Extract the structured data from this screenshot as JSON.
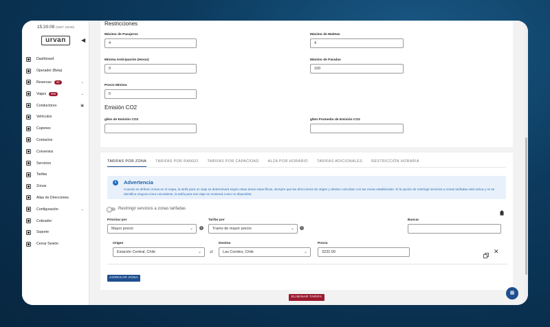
{
  "clock": {
    "time": "15:20:09",
    "tz": "(GMT -04:00)"
  },
  "logo": "urvan",
  "sidebar": {
    "items": [
      {
        "label": "Dashboard",
        "icon": "dashboard-icon"
      },
      {
        "label": "Operador (Beta)",
        "icon": "operator-icon"
      },
      {
        "label": "Reservas",
        "icon": "reservations-icon",
        "badge": "41",
        "expand": true
      },
      {
        "label": "Viajes",
        "icon": "trips-icon",
        "badge": "284",
        "expand": true
      },
      {
        "label": "Conductores",
        "icon": "drivers-icon",
        "extra": true
      },
      {
        "label": "Vehículos",
        "icon": "car-icon"
      },
      {
        "label": "Cupones",
        "icon": "coupon-icon"
      },
      {
        "label": "Contactos",
        "icon": "contacts-icon"
      },
      {
        "label": "Convenios",
        "icon": "agreements-icon"
      },
      {
        "label": "Servicios",
        "icon": "services-icon"
      },
      {
        "label": "Tarifas",
        "icon": "rates-icon"
      },
      {
        "label": "Zonas",
        "icon": "zones-icon"
      },
      {
        "label": "Alias de Direcciones",
        "icon": "location-icon"
      },
      {
        "label": "Configuración",
        "icon": "settings-icon",
        "expand": true
      },
      {
        "label": "Cotizador",
        "icon": "quote-icon"
      },
      {
        "label": "Soporte",
        "icon": "support-icon"
      },
      {
        "label": "Cerrar Sesión",
        "icon": "logout-icon"
      }
    ]
  },
  "restrictions": {
    "title": "Restricciones",
    "max_passengers": {
      "label": "Máximo de Pasajeros",
      "value": "4"
    },
    "max_luggage": {
      "label": "Máximo de Maletas",
      "value": "4"
    },
    "min_advance": {
      "label": "Mínima Anticipación (Horas)",
      "value": "0"
    },
    "max_stops": {
      "label": "Máximo de Paradas",
      "value": "100"
    },
    "min_price": {
      "label": "Precio Mínimo",
      "value": "0"
    }
  },
  "co2": {
    "title": "Emisión CO2",
    "gkm": {
      "label": "g/km de Emisión CO2",
      "value": ""
    },
    "gkm_avg": {
      "label": "g/km Promedio de Emisión CO2",
      "value": ""
    }
  },
  "tabs": [
    "TARIFAS POR ZONA",
    "TARIFAS POR RANGO",
    "TARIFAS POR CAPACIDAD",
    "ALZA POR HORARIO",
    "TARIFAS ADICIONALES",
    "RESTRICCIÓN HORARIA"
  ],
  "alert": {
    "title": "Advertencia",
    "text": "Cuando se definen zonas en el mapa, la tarifa para un viaje se determinará según estas áreas específicas, siempre que las direcciones de origen y destino coincidan con las zonas establecidas. Si la opción de restringir servicios a zonas tarifadas está activa y no se identifica ninguna zona coincidente, la tarifa para ese viaje se mostrará como no disponible."
  },
  "toggle_label": "Restringir servicios a zonas tarifadas",
  "filters": {
    "prioritize": {
      "label": "Priorizar por",
      "value": "Mayor precio"
    },
    "rate_by": {
      "label": "Tarifar por",
      "value": "Tramo de mayor precio"
    },
    "search": {
      "label": "Buscar",
      "value": ""
    }
  },
  "zone": {
    "origin": {
      "label": "Origen",
      "value": "Estación Central, Chile"
    },
    "destination": {
      "label": "Destino",
      "value": "Las Condes, Chile"
    },
    "price": {
      "label": "Precio",
      "value": "3232.00"
    }
  },
  "buttons": {
    "add_zone": "AGREGAR ZONA",
    "delete_rate": "ELIMINAR TARIFA"
  },
  "colors": {
    "primary": "#1e4f8f",
    "danger": "#9b1b30",
    "alert_bg": "#e8f1fb"
  }
}
